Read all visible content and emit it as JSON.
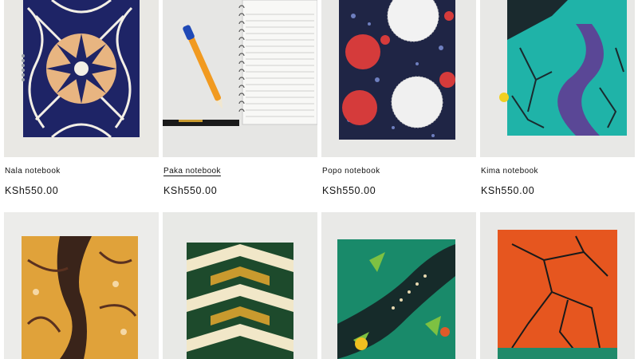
{
  "colors": {
    "background": "#ffffff",
    "text": "#121212",
    "photo_backdrop": "#e6e6e4"
  },
  "products": [
    {
      "title": "Nala notebook",
      "price": "KSh550.00",
      "hovered": false,
      "image_icon": "nala-notebook-photo"
    },
    {
      "title": "Paka notebook",
      "price": "KSh550.00",
      "hovered": true,
      "image_icon": "paka-notebook-photo"
    },
    {
      "title": "Popo notebook",
      "price": "KSh550.00",
      "hovered": false,
      "image_icon": "popo-notebook-photo"
    },
    {
      "title": "Kima notebook",
      "price": "KSh550.00",
      "hovered": false,
      "image_icon": "kima-notebook-photo"
    },
    {
      "image_icon": "brown-tree-print-notebook-photo"
    },
    {
      "image_icon": "green-chevron-print-notebook-photo"
    },
    {
      "image_icon": "green-floral-print-notebook-photo"
    },
    {
      "image_icon": "orange-crackle-print-notebook-photo"
    }
  ]
}
